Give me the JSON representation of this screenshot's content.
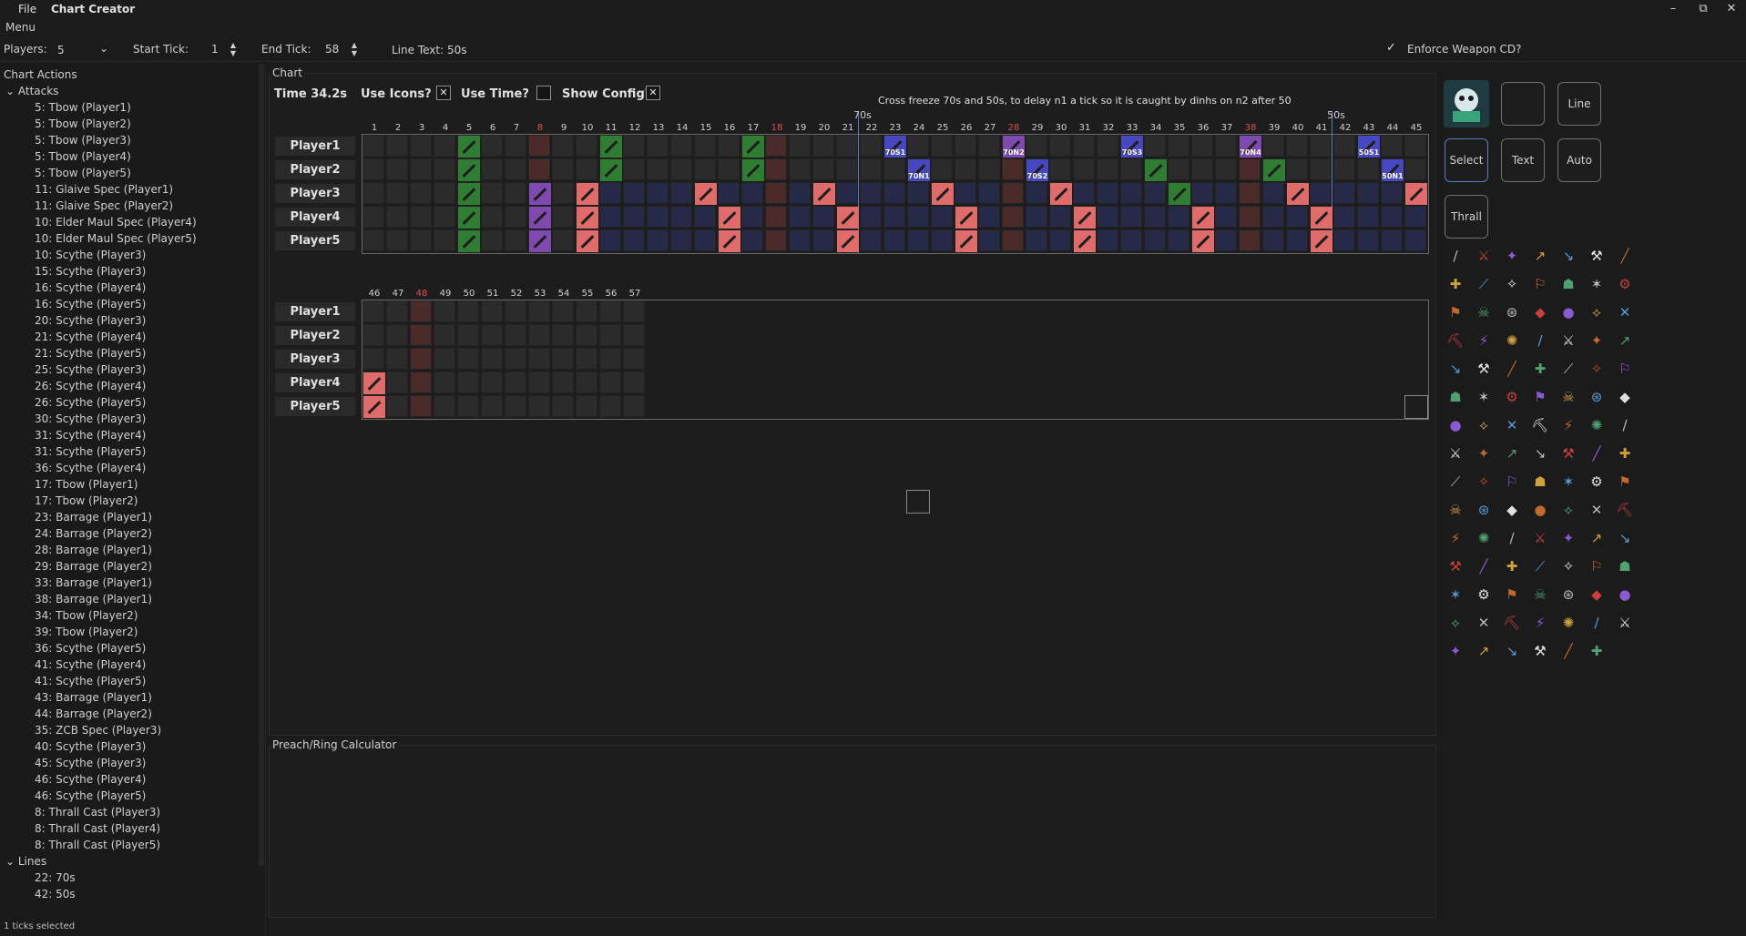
{
  "app": {
    "title": "Chart Creator",
    "file_menu": "File"
  },
  "menubar": {
    "menu": "Menu"
  },
  "window_controls": [
    "–",
    "⧉",
    "✕"
  ],
  "toolbar": {
    "players_label": "Players:",
    "players_value": "5",
    "start_tick_label": "Start Tick:",
    "start_tick_value": "1",
    "end_tick_label": "End Tick:",
    "end_tick_value": "58",
    "line_text": "Line Text: 50s",
    "enforce_label": "Enforce Weapon CD?",
    "enforce_checked": "✓"
  },
  "left": {
    "title": "Chart Actions",
    "attacks_group": "Attacks",
    "lines_group": "Lines",
    "attacks": [
      "5: Tbow (Player1)",
      "5: Tbow (Player2)",
      "5: Tbow (Player3)",
      "5: Tbow (Player4)",
      "5: Tbow (Player5)",
      "11: Glaive Spec (Player1)",
      "11: Glaive Spec (Player2)",
      "10: Elder Maul Spec (Player4)",
      "10: Elder Maul Spec (Player5)",
      "10: Scythe (Player3)",
      "15: Scythe (Player3)",
      "16: Scythe (Player4)",
      "16: Scythe (Player5)",
      "20: Scythe (Player3)",
      "21: Scythe (Player4)",
      "21: Scythe (Player5)",
      "25: Scythe (Player3)",
      "26: Scythe (Player4)",
      "26: Scythe (Player5)",
      "30: Scythe (Player3)",
      "31: Scythe (Player4)",
      "31: Scythe (Player5)",
      "36: Scythe (Player4)",
      "17: Tbow (Player1)",
      "17: Tbow (Player2)",
      "23: Barrage (Player1)",
      "24: Barrage (Player2)",
      "28: Barrage (Player1)",
      "29: Barrage (Player2)",
      "33: Barrage (Player1)",
      "38: Barrage (Player1)",
      "34: Tbow (Player2)",
      "39: Tbow (Player2)",
      "36: Scythe (Player5)",
      "41: Scythe (Player4)",
      "41: Scythe (Player5)",
      "43: Barrage (Player1)",
      "44: Barrage (Player2)",
      "35: ZCB Spec (Player3)",
      "40: Scythe (Player3)",
      "45: Scythe (Player3)",
      "46: Scythe (Player4)",
      "46: Scythe (Player5)",
      "8: Thrall Cast (Player3)",
      "8: Thrall Cast (Player4)",
      "8: Thrall Cast (Player5)"
    ],
    "lines": [
      "22: 70s",
      "42: 50s"
    ],
    "status": "1 ticks selected"
  },
  "chart": {
    "panel_label": "Chart",
    "time": "Time 34.2s",
    "use_icons_label": "Use Icons?",
    "use_icons_checked": "✕",
    "use_time_label": "Use Time?",
    "use_time_checked": "",
    "show_config_label": "Show Config?",
    "show_config_checked": "✕",
    "note": "Cross freeze 70s and 50s, to delay n1 a tick so it is caught by dinhs on n2 after 50",
    "line_labels": [
      "70s",
      "50s"
    ],
    "players": [
      "Player1",
      "Player2",
      "Player3",
      "Player4",
      "Player5"
    ]
  },
  "preach": {
    "label": "Preach/Ring Calculator"
  },
  "tools": {
    "line": "Line",
    "select": "Select",
    "text": "Text",
    "auto": "Auto",
    "thrall": "Thrall"
  },
  "colors": {
    "accent": "#5a7ac0",
    "green": "#2e7d32",
    "pink": "#e06b6b",
    "blue": "#4747c0",
    "purple": "#7f4ab0"
  },
  "chart_data": {
    "type": "table",
    "rows": [
      "Player1",
      "Player2",
      "Player3",
      "Player4",
      "Player5"
    ],
    "ticks_row1": [
      1,
      2,
      3,
      4,
      5,
      6,
      7,
      8,
      9,
      10,
      11,
      12,
      13,
      14,
      15,
      16,
      17,
      18,
      19,
      20,
      21,
      22,
      23,
      24,
      25,
      26,
      27,
      28,
      29,
      30,
      31,
      32,
      33,
      34,
      35,
      36,
      37,
      38,
      39,
      40,
      41,
      42,
      43,
      44,
      45
    ],
    "ticks_row2": [
      46,
      47,
      48,
      49,
      50,
      51,
      52,
      53,
      54,
      55,
      56,
      57
    ],
    "highlight_ticks": [
      8,
      18,
      28,
      38,
      48
    ],
    "cells": [
      {
        "tick": 5,
        "player": "Player1",
        "color": "green"
      },
      {
        "tick": 5,
        "player": "Player2",
        "color": "green"
      },
      {
        "tick": 5,
        "player": "Player3",
        "color": "green"
      },
      {
        "tick": 5,
        "player": "Player4",
        "color": "green"
      },
      {
        "tick": 5,
        "player": "Player5",
        "color": "green"
      },
      {
        "tick": 11,
        "player": "Player1",
        "color": "green"
      },
      {
        "tick": 11,
        "player": "Player2",
        "color": "green"
      },
      {
        "tick": 8,
        "player": "Player3",
        "color": "purple"
      },
      {
        "tick": 8,
        "player": "Player4",
        "color": "purple"
      },
      {
        "tick": 8,
        "player": "Player5",
        "color": "purple"
      },
      {
        "tick": 10,
        "player": "Player3",
        "color": "pink"
      },
      {
        "tick": 10,
        "player": "Player4",
        "color": "pink"
      },
      {
        "tick": 10,
        "player": "Player5",
        "color": "pink"
      },
      {
        "tick": 15,
        "player": "Player3",
        "color": "pink"
      },
      {
        "tick": 16,
        "player": "Player4",
        "color": "pink"
      },
      {
        "tick": 16,
        "player": "Player5",
        "color": "pink"
      },
      {
        "tick": 17,
        "player": "Player1",
        "color": "green"
      },
      {
        "tick": 17,
        "player": "Player2",
        "color": "green"
      },
      {
        "tick": 20,
        "player": "Player3",
        "color": "pink"
      },
      {
        "tick": 21,
        "player": "Player4",
        "color": "pink"
      },
      {
        "tick": 21,
        "player": "Player5",
        "color": "pink"
      },
      {
        "tick": 23,
        "player": "Player1",
        "color": "blue",
        "text": "70S1"
      },
      {
        "tick": 24,
        "player": "Player2",
        "color": "blue",
        "text": "70N1"
      },
      {
        "tick": 25,
        "player": "Player3",
        "color": "pink"
      },
      {
        "tick": 26,
        "player": "Player4",
        "color": "pink"
      },
      {
        "tick": 26,
        "player": "Player5",
        "color": "pink"
      },
      {
        "tick": 28,
        "player": "Player1",
        "color": "purple",
        "text": "70N2"
      },
      {
        "tick": 29,
        "player": "Player2",
        "color": "blue",
        "text": "70S2"
      },
      {
        "tick": 30,
        "player": "Player3",
        "color": "pink"
      },
      {
        "tick": 31,
        "player": "Player4",
        "color": "pink"
      },
      {
        "tick": 31,
        "player": "Player5",
        "color": "pink"
      },
      {
        "tick": 33,
        "player": "Player1",
        "color": "blue",
        "text": "70S3"
      },
      {
        "tick": 34,
        "player": "Player2",
        "color": "green"
      },
      {
        "tick": 35,
        "player": "Player3",
        "color": "green"
      },
      {
        "tick": 36,
        "player": "Player4",
        "color": "pink"
      },
      {
        "tick": 36,
        "player": "Player5",
        "color": "pink"
      },
      {
        "tick": 38,
        "player": "Player1",
        "color": "purple",
        "text": "70N4"
      },
      {
        "tick": 39,
        "player": "Player2",
        "color": "green"
      },
      {
        "tick": 40,
        "player": "Player3",
        "color": "pink"
      },
      {
        "tick": 41,
        "player": "Player4",
        "color": "pink"
      },
      {
        "tick": 41,
        "player": "Player5",
        "color": "pink"
      },
      {
        "tick": 43,
        "player": "Player1",
        "color": "blue",
        "text": "50S1"
      },
      {
        "tick": 44,
        "player": "Player2",
        "color": "blue",
        "text": "50N1"
      },
      {
        "tick": 45,
        "player": "Player3",
        "color": "pink"
      },
      {
        "tick": 46,
        "player": "Player4",
        "color": "pink"
      },
      {
        "tick": 46,
        "player": "Player5",
        "color": "pink"
      }
    ],
    "lines": [
      {
        "tick": 22,
        "label": "70s"
      },
      {
        "tick": 42,
        "label": "50s"
      }
    ]
  }
}
